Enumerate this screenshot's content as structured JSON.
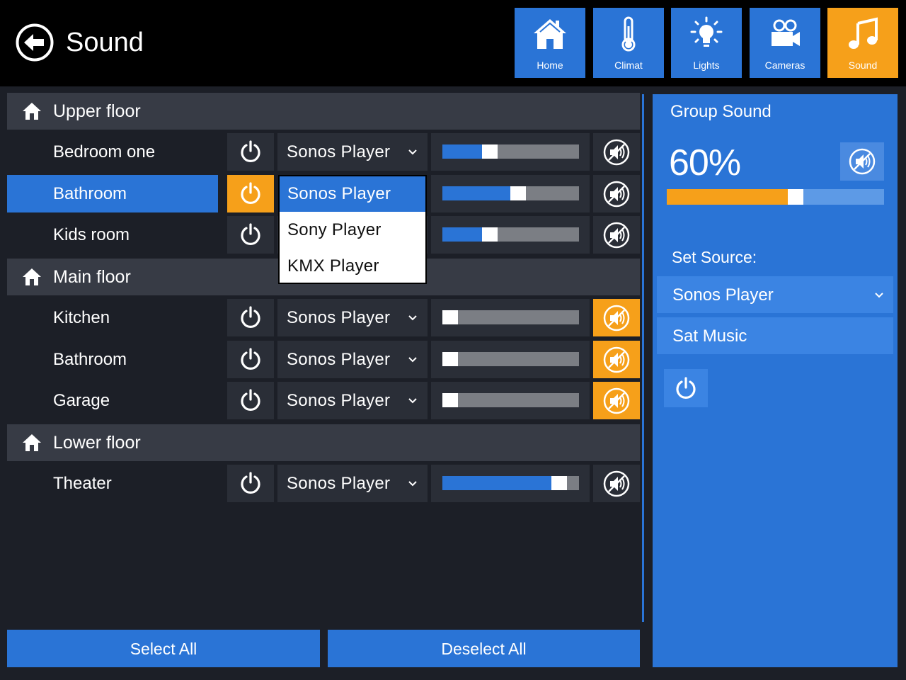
{
  "header": {
    "title": "Sound",
    "back_icon": "back-arrow-icon",
    "nav": [
      {
        "label": "Home",
        "icon": "home-icon",
        "active": false
      },
      {
        "label": "Climat",
        "icon": "thermometer-icon",
        "active": false
      },
      {
        "label": "Lights",
        "icon": "lightbulb-icon",
        "active": false
      },
      {
        "label": "Cameras",
        "icon": "camera-icon",
        "active": false
      },
      {
        "label": "Sound",
        "icon": "music-note-icon",
        "active": true
      }
    ]
  },
  "floors": [
    {
      "name": "Upper floor",
      "rooms": [
        {
          "name": "Bedroom one",
          "selected": false,
          "power_on": false,
          "source": "Sonos Player",
          "volume_pct": 33,
          "muted": false
        },
        {
          "name": "Bathroom",
          "selected": true,
          "power_on": true,
          "source": "Sonos Player",
          "volume_pct": 56,
          "muted": false
        },
        {
          "name": "Kids room",
          "selected": false,
          "power_on": false,
          "source": "Sonos Player",
          "volume_pct": 33,
          "muted": false
        }
      ]
    },
    {
      "name": "Main floor",
      "rooms": [
        {
          "name": "Kitchen",
          "selected": false,
          "power_on": false,
          "source": "Sonos Player",
          "volume_pct": 0,
          "muted": true
        },
        {
          "name": "Bathroom",
          "selected": false,
          "power_on": false,
          "source": "Sonos Player",
          "volume_pct": 0,
          "muted": true
        },
        {
          "name": "Garage",
          "selected": false,
          "power_on": false,
          "source": "Sonos Player",
          "volume_pct": 0,
          "muted": true
        }
      ]
    },
    {
      "name": "Lower floor",
      "rooms": [
        {
          "name": "Theater",
          "selected": false,
          "power_on": false,
          "source": "Sonos Player",
          "volume_pct": 90,
          "muted": false
        }
      ]
    }
  ],
  "dropdown": {
    "options": [
      "Sonos Player",
      "Sony Player",
      "KMX Player"
    ],
    "selected": "Sonos Player"
  },
  "actions": {
    "select_all": "Select All",
    "deselect_all": "Deselect All"
  },
  "group": {
    "title": "Group Sound",
    "volume_text": "60%",
    "volume_pct": 60,
    "set_source_label": "Set Source:",
    "sources": [
      "Sonos Player",
      "Sat Music"
    ]
  },
  "colors": {
    "accent_blue": "#2a74d6",
    "accent_orange": "#f6a01a",
    "panel_dark": "#2a2e37",
    "header_gray": "#373b45"
  }
}
